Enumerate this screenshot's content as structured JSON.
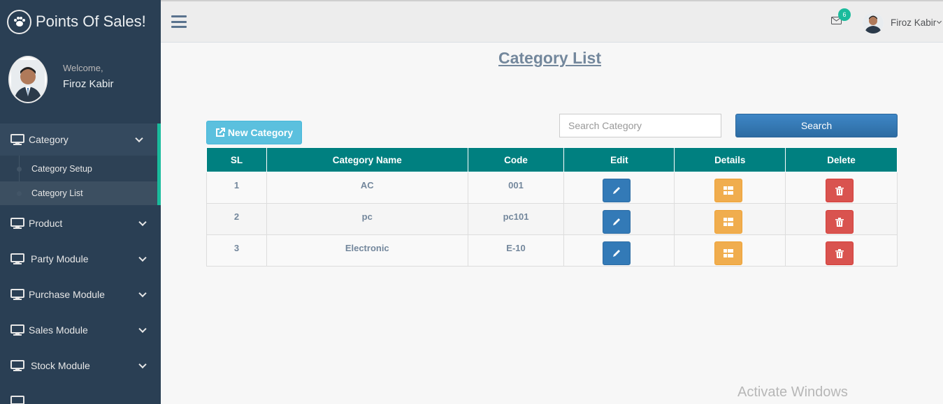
{
  "brand": {
    "title": "Points Of Sales!"
  },
  "profile": {
    "welcome": "Welcome,",
    "name": "Firoz Kabir"
  },
  "sidebar": {
    "category": {
      "label": "Category",
      "sub": [
        "Category Setup",
        "Category List"
      ]
    },
    "items": [
      "Product",
      "Party Module",
      "Purchase Module",
      "Sales Module",
      "Stock Module"
    ]
  },
  "topnav": {
    "mail_badge": "6",
    "user_name": "Firoz Kabir"
  },
  "page": {
    "title": "Category List",
    "new_button": "New Category",
    "search_placeholder": "Search Category",
    "search_button": "Search"
  },
  "table": {
    "headers": [
      "SL",
      "Category Name",
      "Code",
      "Edit",
      "Details",
      "Delete"
    ],
    "rows": [
      {
        "sl": "1",
        "name": "AC",
        "code": "001"
      },
      {
        "sl": "2",
        "name": "pc",
        "code": "pc101"
      },
      {
        "sl": "3",
        "name": "Electronic",
        "code": "E-10"
      }
    ]
  },
  "colors": {
    "sidebar": "#2a3f54",
    "accent": "#1abb9c",
    "table_header": "#008080"
  },
  "watermark": "Activate Windows"
}
